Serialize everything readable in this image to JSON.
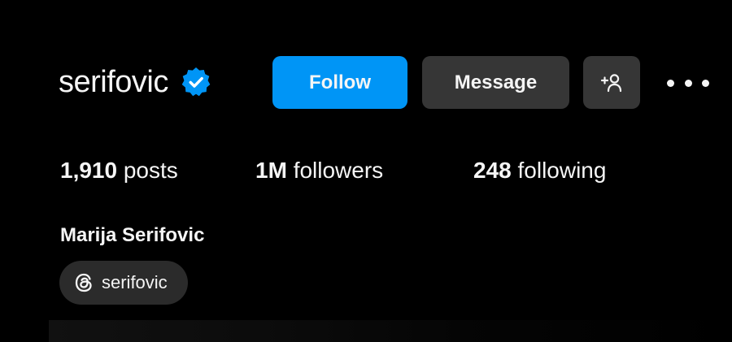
{
  "profile": {
    "username": "serifovic",
    "verified": true,
    "full_name": "Marija Serifovic"
  },
  "actions": {
    "follow_label": "Follow",
    "message_label": "Message",
    "add_user_icon": "add-user-icon",
    "more_icon": "more-options-icon"
  },
  "stats": {
    "posts": {
      "value": "1,910",
      "label": "posts"
    },
    "followers": {
      "value": "1M",
      "label": "followers"
    },
    "following": {
      "value": "248",
      "label": "following"
    }
  },
  "threads_link": {
    "icon": "threads-icon",
    "handle": "serifovic"
  },
  "colors": {
    "background": "#000000",
    "text": "#f5f5f5",
    "primary_button": "#0095f6",
    "secondary_button": "#363636",
    "verified_badge": "#0095f6",
    "pill": "#2b2b2b"
  }
}
